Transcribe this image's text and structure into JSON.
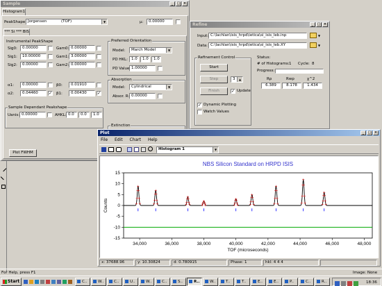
{
  "sample_window": {
    "title": "Sample",
    "tab_histogram": "Histogram1",
    "peak_shape_label": "PeakShape:",
    "peak_shape_value": "Jorgensen",
    "peak_shape_type": "(TOF)",
    "mu_label": "µ:",
    "mu_value": "0.00000",
    "phase_tab": "*** Si *** BIS",
    "instr_group": "Instrumental PeakShape",
    "sig_rows": [
      {
        "label": "Sig0:",
        "value": "0.00000",
        "gam_label": "Gam0:",
        "gam_value": "0.00000"
      },
      {
        "label": "Sig1:",
        "value": "10.00000",
        "gam_label": "Gam1:",
        "gam_value": "3.00000"
      },
      {
        "label": "Sig2:",
        "value": "0.00000",
        "gam_label": "Gam2:",
        "gam_value": "0.00000"
      }
    ],
    "alpha_rows": [
      {
        "label": "α1:",
        "value": "0.00000",
        "beta_label": "β0:",
        "beta_value": "0.01910"
      },
      {
        "label": "α2:",
        "value": "0.04460",
        "beta_label": "β1:",
        "beta_value": "0.00430"
      }
    ],
    "sample_group": "Sample Dependant Peakshape",
    "uanis_label": "Uanis:",
    "uanis_value": "0.00000",
    "ahkl_label": "AHKL:",
    "ahkl_values": [
      "0.0",
      "0.0",
      "1.0"
    ],
    "pref_group": "Preferred Orientation",
    "model_label": "Model:",
    "model_value": "March Model",
    "pd_hkl_label": "PD HKL:",
    "pd_hkl_values": [
      "1.0",
      "1.0",
      "1.0"
    ],
    "pd_value_label": "PD Value:",
    "pd_value": "1.00000",
    "abs_group": "Absorption",
    "abs_model_label": "Model:",
    "abs_model_value": "Cylindrical",
    "abs_r_label": "Absor. R:",
    "abs_r_value": "0.00000",
    "ext_group": "Extinction",
    "plot_fwhm": "Plot FWHM"
  },
  "refine_window": {
    "title": "Refine",
    "input_label": "Input:",
    "input_value": "C:\\lachlan\\isis_hrpd\\ietica\\si_isis_leb.inp",
    "data_label": "Data:",
    "data_value": "C:\\lachlan\\isis_hrpd\\ietica\\si_isis_leb.XY",
    "control_group": "Refinement Control",
    "start": "Start",
    "step": "Step",
    "step_count": "3",
    "finish": "Finish",
    "update": "Update",
    "dynamic_plotting": "Dynamic Plotting",
    "watch_values": "Watch Values",
    "status_group": "Status:",
    "histograms_label": "# of Histograms:",
    "histograms_value": "1",
    "cycle_label": "Cycle:",
    "cycle_value": "8",
    "progress_label": "Progress:",
    "rp_label": "Rp",
    "rwp_label": "Rwp",
    "chi2_label": "χ^2",
    "rp_value": "6.389",
    "rwp_value": "8.178",
    "chi2_value": "1.434"
  },
  "plot_window": {
    "title": "Plot",
    "menu": [
      "File",
      "Edit",
      "Chart",
      "Help"
    ],
    "histogram_select": "Histogram 1",
    "status": {
      "x": "x: 37688.96",
      "y": "y: 10.30824",
      "d": "d: 0.780915",
      "phase": "Phase: 1",
      "hkl": "hkl: 4 4 4"
    }
  },
  "chart_data": {
    "type": "line",
    "title": "NBS Silicon Standard on HRPD ISIS",
    "xlabel": "TOF (microseconds)",
    "ylabel": "Counts",
    "xlim": [
      33000,
      48500
    ],
    "ylim": [
      -15,
      15
    ],
    "x_ticks": [
      34000,
      36000,
      38000,
      40000,
      42000,
      44000,
      46000,
      48000
    ],
    "x_tick_labels": [
      "34,000",
      "36,000",
      "38,000",
      "40,000",
      "42,000",
      "44,000",
      "46,000",
      "48,000"
    ],
    "y_ticks": [
      -15,
      -10,
      -5,
      0,
      5,
      10,
      15
    ],
    "y_tick_labels": [
      "-15",
      "-10",
      "-5",
      "0",
      "5",
      "10",
      "15"
    ],
    "background": 0,
    "peaks": [
      {
        "x": 33900,
        "height": 9
      },
      {
        "x": 35000,
        "height": 7
      },
      {
        "x": 37000,
        "height": 4
      },
      {
        "x": 38000,
        "height": 2
      },
      {
        "x": 40000,
        "height": 3
      },
      {
        "x": 41000,
        "height": 5
      },
      {
        "x": 42500,
        "height": 9
      },
      {
        "x": 44200,
        "height": 12
      },
      {
        "x": 45500,
        "height": 6
      }
    ],
    "tick_marks_y": -2,
    "difference_offset": -10,
    "grid": false,
    "colors": {
      "observed": "#cc0000",
      "calculated": "#000000",
      "ticks": "#0000ff",
      "difference": "#00aa00",
      "title": "#3333cc"
    }
  },
  "app_status": "For Help, press F1",
  "image_status": "Image: None",
  "taskbar": {
    "start": "Start",
    "buttons": [
      "C..",
      "W..",
      "C..",
      "U..",
      "W..",
      "C..",
      "S..",
      "R..",
      "W..",
      "T..",
      "T..",
      "E..",
      "E..",
      "P..",
      "C..",
      "R.."
    ],
    "clock": "18:36"
  }
}
